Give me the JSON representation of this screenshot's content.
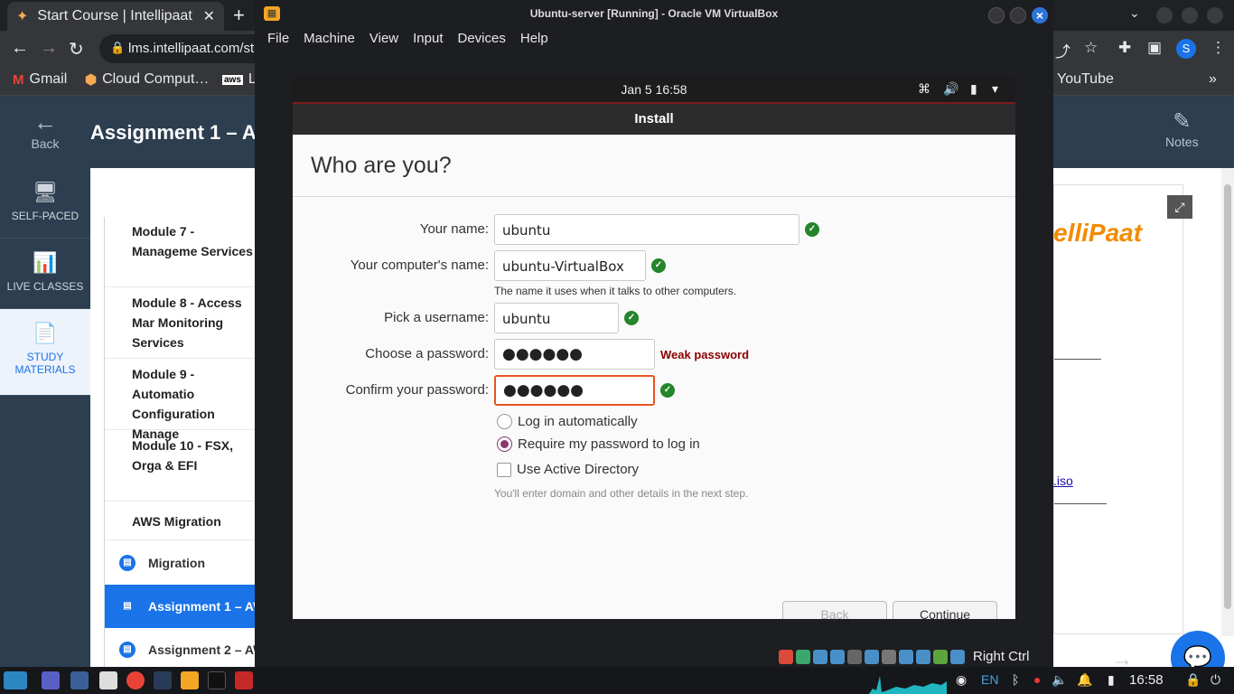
{
  "browser": {
    "tab_title": "Start Course | Intellipaat",
    "url": "lms.intellipaat.com/sta",
    "profile_initial": "S",
    "bookmarks": [
      "Gmail",
      "Cloud Comput…",
      "Le",
      "YouTube"
    ]
  },
  "site": {
    "back_label": "Back",
    "page_title": "Assignment 1 – AW",
    "notes_label": "Notes",
    "left_nav": [
      "SELF-PACED",
      "LIVE CLASSES",
      "STUDY MATERIALS"
    ],
    "modules": [
      "Module 7 - Manageme Services",
      "Module 8 - Access Mar Monitoring Services",
      "Module 9 - Automatio Configuration Manage",
      "Module 10 - FSX, Orga & EFI",
      "AWS Migration"
    ],
    "items": [
      "Migration",
      "Assignment 1 – AW",
      "Assignment 2 – AW"
    ],
    "iso_link": ".iso",
    "logo_text": "elliPaat"
  },
  "vbox": {
    "title": "Ubuntu-server [Running] - Oracle VM VirtualBox",
    "menu": [
      "File",
      "Machine",
      "View",
      "Input",
      "Devices",
      "Help"
    ],
    "host_key": "Right Ctrl"
  },
  "ubuntu": {
    "clock": "Jan 5  16:58",
    "window_title": "Install",
    "heading": "Who are you?",
    "labels": {
      "name": "Your name:",
      "computer": "Your computer's name:",
      "username": "Pick a username:",
      "password": "Choose a password:",
      "confirm": "Confirm your password:"
    },
    "values": {
      "name": "ubuntu",
      "computer": "ubuntu-VirtualBox",
      "username": "ubuntu",
      "password": "●●●●●●",
      "confirm": "●●●●●●"
    },
    "computer_hint": "The name it uses when it talks to other computers.",
    "password_strength": "Weak password",
    "login_auto": "Log in automatically",
    "login_password": "Require my password to log in",
    "active_directory": "Use Active Directory",
    "ad_hint": "You'll enter domain and other details in the next step.",
    "back_button": "Back",
    "continue_button": "Continue"
  },
  "taskbar": {
    "lang": "EN",
    "time": "16:58"
  },
  "colors": {
    "accent_orange": "#e95420",
    "check_green": "#24852b",
    "radio_purple": "#88386b",
    "weak_red": "#8b0000",
    "site_blue": "#1a73e8"
  }
}
